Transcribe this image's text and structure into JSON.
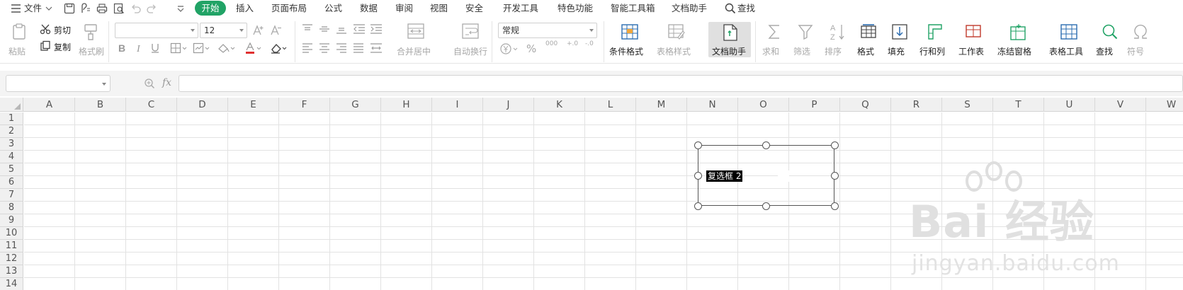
{
  "menu": {
    "file_label": "文件",
    "tabs": [
      {
        "label": "开始",
        "active": true
      },
      {
        "label": "插入"
      },
      {
        "label": "页面布局"
      },
      {
        "label": "公式"
      },
      {
        "label": "数据"
      },
      {
        "label": "审阅"
      },
      {
        "label": "视图"
      },
      {
        "label": "安全"
      },
      {
        "label": "开发工具"
      },
      {
        "label": "特色功能"
      },
      {
        "label": "智能工具箱"
      },
      {
        "label": "文档助手"
      }
    ],
    "search_label": "查找"
  },
  "ribbon": {
    "paste_label": "粘贴",
    "cut_label": "剪切",
    "copy_label": "复制",
    "format_painter_label": "格式刷",
    "font_name": "",
    "font_size": "12",
    "number_format": "常规",
    "merge_center_label": "合并居中",
    "wrap_text_label": "自动换行",
    "conditional_format_label": "条件格式",
    "table_style_label": "表格样式",
    "doc_assistant_label": "文档助手",
    "sum_label": "求和",
    "filter_label": "筛选",
    "sort_label": "排序",
    "format_label": "格式",
    "fill_label": "填充",
    "row_col_label": "行和列",
    "worksheet_label": "工作表",
    "freeze_label": "冻结窗格",
    "table_tools_label": "表格工具",
    "find_label": "查找",
    "symbol_label": "符号",
    "percent_symbol": "%",
    "thousands_symbol": "000",
    "decimal_increase": "+.0",
    "decimal_decrease": "-.0"
  },
  "formula_bar": {
    "name_box_value": "",
    "fx_label": "fx",
    "formula_value": ""
  },
  "grid": {
    "columns": [
      "A",
      "B",
      "C",
      "D",
      "E",
      "F",
      "G",
      "H",
      "I",
      "J",
      "K",
      "L",
      "M",
      "N",
      "O",
      "P",
      "Q",
      "R",
      "S",
      "T",
      "U",
      "V",
      "W"
    ],
    "rows": [
      "1",
      "2",
      "3",
      "4",
      "5",
      "6",
      "7",
      "8",
      "9",
      "10",
      "11",
      "12",
      "13",
      "14"
    ]
  },
  "checkbox": {
    "label": "复选框 2",
    "checked": false
  },
  "watermark": {
    "text": "Bai 经验",
    "url": "jingyan.baidu.com"
  },
  "colors": {
    "accent": "#21a366",
    "grid_line": "#e2e2e2",
    "header_bg": "#f0f0f0"
  }
}
